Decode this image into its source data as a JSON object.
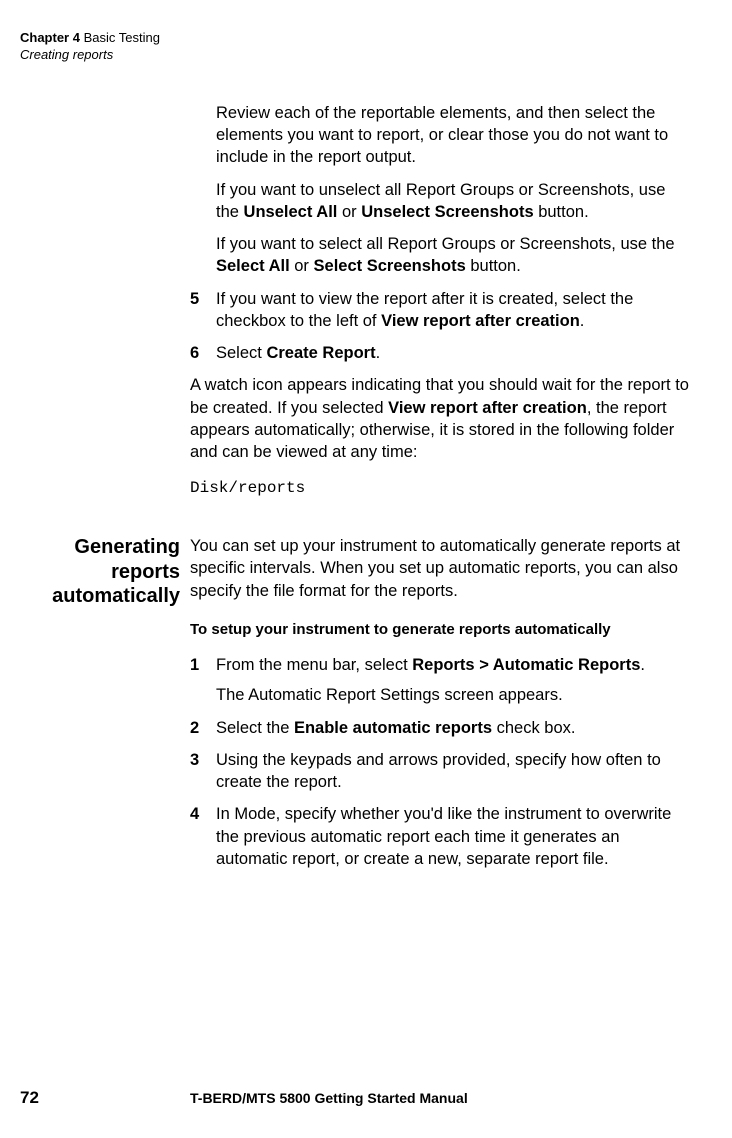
{
  "header": {
    "chapter_label": "Chapter 4",
    "chapter_title": "Basic Testing",
    "section_title": "Creating reports"
  },
  "body": {
    "review_p": "Review each of the reportable elements, and then select the elements you want to report, or clear those you do not want to include in the report output.",
    "unselect_p_pre": "If you want to unselect all Report Groups or Screenshots, use the ",
    "unselect_all": "Unselect All",
    "or1": " or ",
    "unselect_screens": "Unselect Screenshots",
    "btn_suffix": " button.",
    "select_p_pre": "If you want to select all Report Groups or Screenshots, use the ",
    "select_all": "Select All",
    "select_screens": "Select Screenshots",
    "step5_num": "5",
    "step5_pre": "If you want to view the report after it is created, select the checkbox to the left of ",
    "view_after": "View report after creation",
    "period": ".",
    "step6_num": "6",
    "step6_pre": "Select ",
    "create_report": "Create Report",
    "watch_p_pre": "A watch icon appears indicating that you should wait for the report to be created. If you selected ",
    "watch_p_post": ", the report appears automatically; otherwise, it is stored in the following folder and can be viewed at any time:",
    "disk_path": "Disk/reports"
  },
  "section2": {
    "heading_l1": "Generating",
    "heading_l2": "reports",
    "heading_l3": "automatically",
    "intro": "You can set up your instrument to automatically generate reports at specific intervals. When you set up automatic reports, you can also specify the file format for the reports.",
    "subhead": "To setup your instrument to generate reports automatically",
    "s1_num": "1",
    "s1_pre": "From the menu bar, select ",
    "s1_bold": "Reports > Automatic Reports",
    "s1_sub": "The Automatic Report Settings screen appears.",
    "s2_num": "2",
    "s2_pre": "Select the ",
    "s2_bold": "Enable automatic reports",
    "s2_post": " check box.",
    "s3_num": "3",
    "s3_text": "Using the keypads and arrows provided, specify how often to create the report.",
    "s4_num": "4",
    "s4_text": "In Mode, specify whether you'd like the instrument to overwrite the previous automatic report each time it generates an automatic report, or create a new, separate report file."
  },
  "footer": {
    "page_num": "72",
    "title": "T-BERD/MTS 5800 Getting Started Manual"
  }
}
